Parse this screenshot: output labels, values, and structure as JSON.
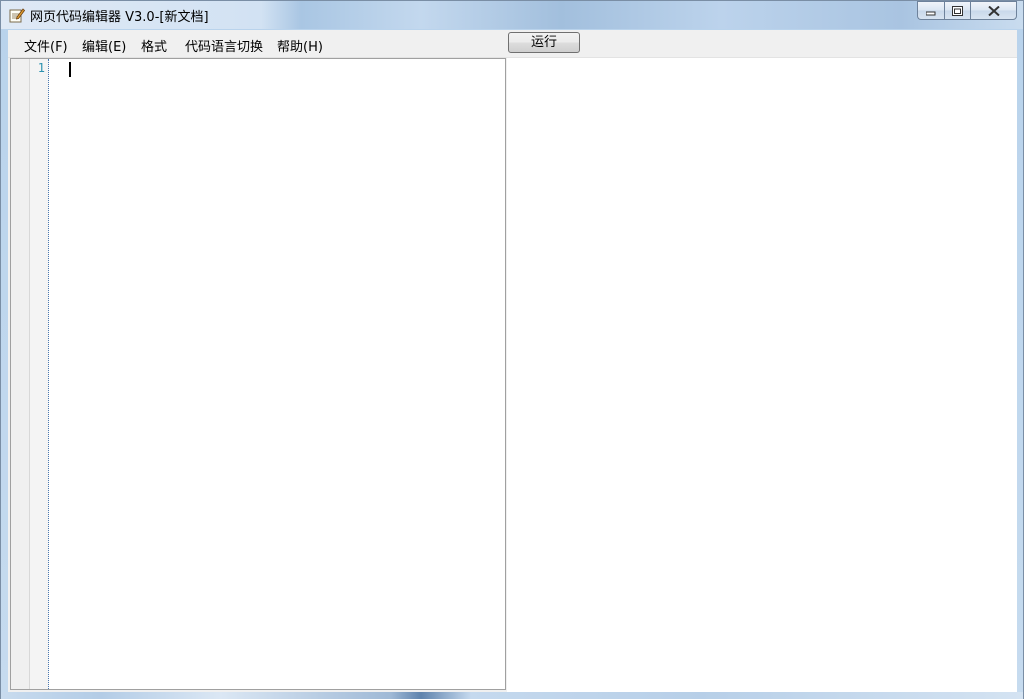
{
  "window": {
    "title": "网页代码编辑器 V3.0-[新文档]",
    "icon": "notepad-pencil-icon"
  },
  "caption_buttons": {
    "minimize_icon": "minimize-icon",
    "maximize_icon": "restore-icon",
    "close_icon": "close-icon"
  },
  "menu": {
    "items": [
      {
        "label": "文件(F)"
      },
      {
        "label": "编辑(E)"
      },
      {
        "label": "格式"
      },
      {
        "label": "代码语言切换"
      },
      {
        "label": "帮助(H)"
      }
    ],
    "run_label": "运行"
  },
  "editor": {
    "line_numbers": [
      "1"
    ],
    "content": ""
  },
  "colors": {
    "line_number": "#2b91af",
    "menubar_bg": "#f0f0f0",
    "editor_bg": "#ffffff"
  }
}
